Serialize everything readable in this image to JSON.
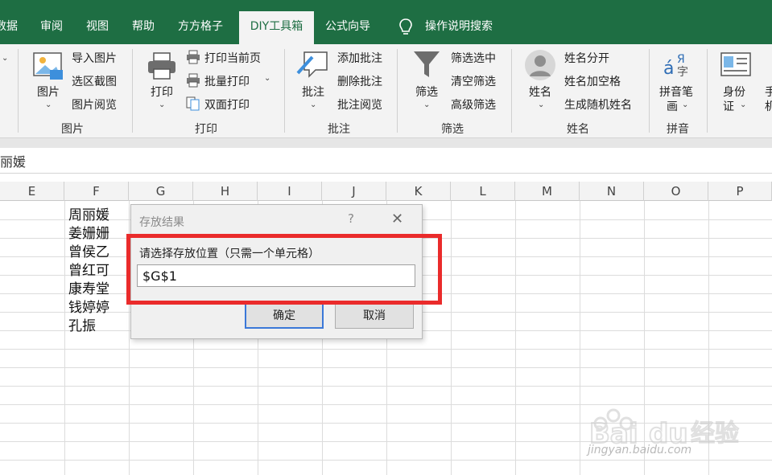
{
  "tabs": [
    {
      "label": "数据",
      "active": false
    },
    {
      "label": "审阅",
      "active": false
    },
    {
      "label": "视图",
      "active": false
    },
    {
      "label": "帮助",
      "active": false
    },
    {
      "label": "方方格子",
      "active": false
    },
    {
      "label": "DIY工具箱",
      "active": true
    },
    {
      "label": "公式向导",
      "active": false
    },
    {
      "label": "操作说明搜索",
      "active": false
    }
  ],
  "ribbon": {
    "picture": {
      "big_label": "图片",
      "items": [
        "导入图片",
        "选区截图",
        "图片阅览"
      ],
      "group_label": "图片"
    },
    "print": {
      "big_label": "打印",
      "items": [
        "打印当前页",
        "批量打印",
        "双面打印"
      ],
      "group_label": "打印"
    },
    "comment": {
      "big_label": "批注",
      "items": [
        "添加批注",
        "删除批注",
        "批注阅览"
      ],
      "group_label": "批注"
    },
    "filter": {
      "big_label": "筛选",
      "items": [
        "筛选选中",
        "清空筛选",
        "高级筛选"
      ],
      "group_label": "筛选"
    },
    "name": {
      "big_label": "姓名",
      "items": [
        "姓名分开",
        "姓名加空格",
        "生成随机姓名"
      ],
      "group_label": "姓名"
    },
    "pinyin": {
      "big_label_1": "拼音笔",
      "big_label_2": "画",
      "group_label": "拼音"
    },
    "id": {
      "big_label_1": "身份",
      "big_label_2": "证"
    },
    "cut": {
      "big_label_1": "手",
      "big_label_2": "机"
    }
  },
  "formula_bar": {
    "value": "丽媛"
  },
  "columns": [
    "E",
    "F",
    "G",
    "H",
    "I",
    "J",
    "K",
    "L",
    "M",
    "N",
    "O",
    "P"
  ],
  "names": [
    "周丽媛",
    "姜姗姗",
    "曾侯乙",
    "曾红可",
    "康寿堂",
    "钱婷婷",
    "孔振"
  ],
  "dialog": {
    "title": "存放结果",
    "help": "?",
    "close": "✕",
    "prompt": "请选择存放位置（只需一个单元格）",
    "input_value": "$G$1",
    "ok_label": "确定",
    "cancel_label": "取消"
  },
  "watermark": {
    "brand": "Bai经验",
    "url": "jingyan.baidu.com"
  },
  "colors": {
    "excel_green": "#1e6e43",
    "highlight_red": "#ea2b2b",
    "focus_blue": "#3b78d8"
  }
}
